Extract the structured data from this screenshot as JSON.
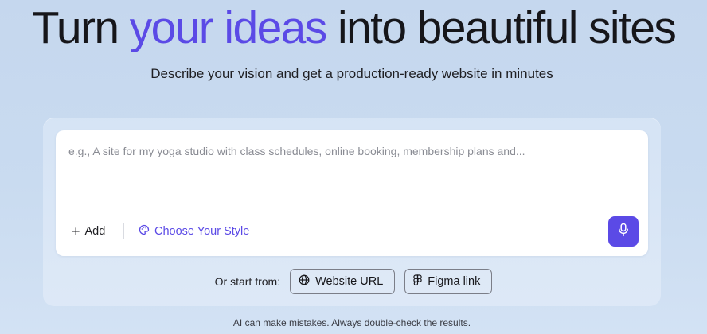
{
  "hero": {
    "headline_before": "Turn ",
    "headline_accent": "your ideas",
    "headline_after": " into beautiful sites",
    "subtitle": "Describe your vision and get a production-ready website in minutes"
  },
  "prompt": {
    "value": "",
    "placeholder": "e.g., A site for my yoga studio with class schedules, online booking, membership plans and..."
  },
  "toolbar": {
    "add_label": "Add",
    "style_label": "Choose Your Style",
    "add_icon": "plus-icon",
    "style_icon": "palette-icon",
    "mic_icon": "microphone-icon"
  },
  "start_from": {
    "label": "Or start from:",
    "options": [
      {
        "label": "Website URL",
        "icon": "globe-icon"
      },
      {
        "label": "Figma link",
        "icon": "figma-icon"
      }
    ]
  },
  "disclaimer": "AI can make mistakes. Always double-check the results.",
  "colors": {
    "accent": "#5b4ae6",
    "background": "#c9dbf0",
    "text": "#16161a"
  }
}
